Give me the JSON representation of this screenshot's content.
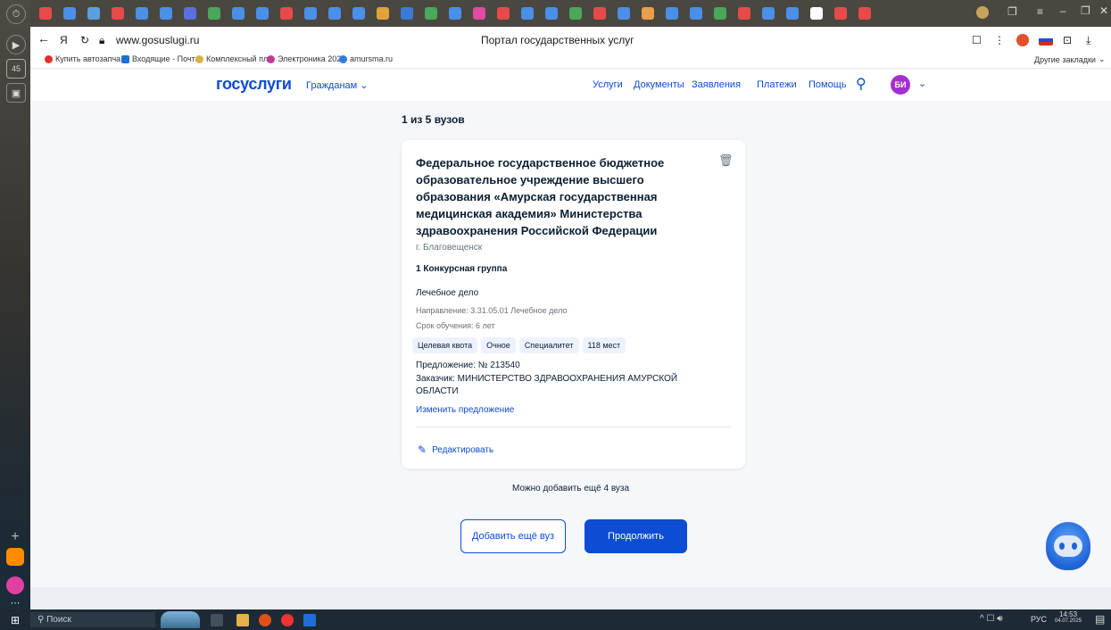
{
  "browser": {
    "sidebar_badge": "45",
    "url": "www.gosuslugi.ru",
    "page_title": "Портал государственных услуг",
    "bookmarks": [
      "Купить автозапча",
      "Входящие - Почта",
      "Комплексный пла",
      "Электроника 202",
      "amursma.ru"
    ],
    "other_bookmarks": "Другие закладки"
  },
  "site": {
    "logo": "госуслуги",
    "audience": "Гражданам",
    "nav": [
      "Услуги",
      "Документы",
      "Заявления",
      "Платежи",
      "Помощь"
    ],
    "avatar_initials": "БИ"
  },
  "main": {
    "heading": "1 из 5 вузов",
    "card": {
      "title": "Федеральное государственное бюджетное образовательное учреждение высшего образования «Амурская государственная медицинская академия» Министерства здравоохранения Российской Федерации",
      "city": "г. Благовещенск",
      "group": "1 Конкурсная группа",
      "program": "Лечебное дело",
      "direction": "Направление: 3.31.05.01 Лечебное дело",
      "duration": "Срок обучения: 6 лет",
      "chips": [
        "Целевая квота",
        "Очное",
        "Специалитет",
        "118 мест"
      ],
      "offer": "Предложение: № 213540",
      "customer": "Заказчик: МИНИСТЕРСТВО ЗДРАВООХРАНЕНИЯ АМУРСКОЙ ОБЛАСТИ",
      "change_offer": "Изменить предложение",
      "edit": "Редактировать"
    },
    "can_add": "Можно добавить ещё 4 вуза",
    "add_button": "Добавить ещё вуз",
    "continue_button": "Продолжить"
  },
  "taskbar": {
    "search": "Поиск",
    "lang": "РУС",
    "time": "14:53",
    "date": "04.07.2025"
  },
  "colors": {
    "brand_blue": "#0d4cd3",
    "brand_red": "#ee3f58",
    "avatar": "#a52fd3"
  }
}
